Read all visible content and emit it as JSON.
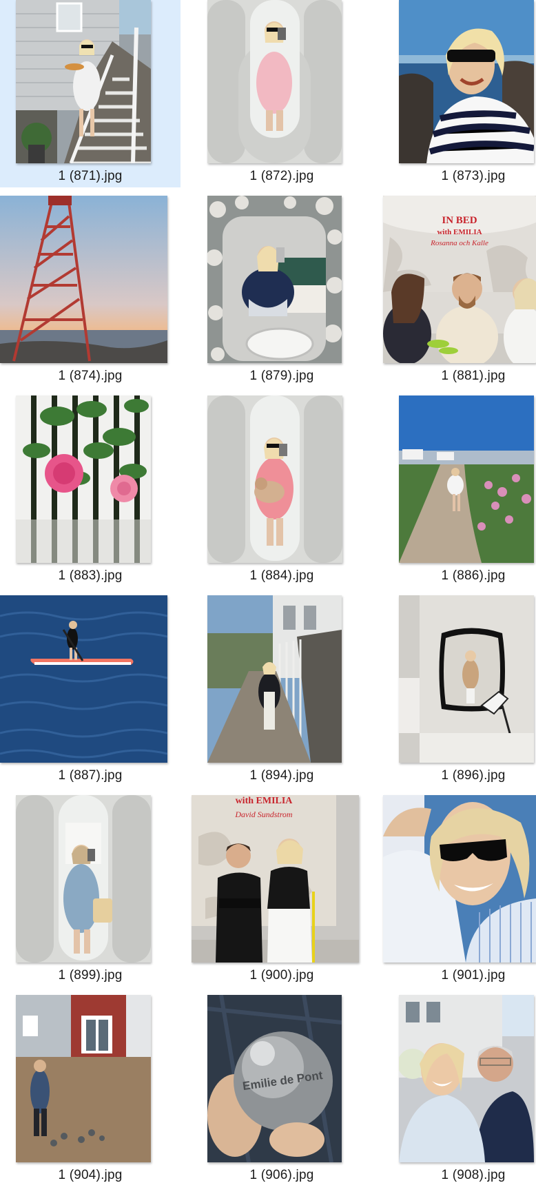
{
  "gallery": {
    "selected_index": 0,
    "files": [
      {
        "name": "1 (871).jpg",
        "scene": "woman-on-stairs-photo"
      },
      {
        "name": "1 (872).jpg",
        "scene": "mirror-selfie-photo"
      },
      {
        "name": "1 (873).jpg",
        "scene": "seaside-selfie-photo"
      },
      {
        "name": "1 (874).jpg",
        "scene": "lighthouse-sunset-photo"
      },
      {
        "name": "1 (879).jpg",
        "scene": "floral-mirror-selfie-photo"
      },
      {
        "name": "1 (881).jpg",
        "scene": "podcast-group-photo",
        "overlay_lines": [
          "IN BED",
          "with EMILIA",
          "Rosanna och Kalle"
        ]
      },
      {
        "name": "1 (883).jpg",
        "scene": "pink-rose-photo"
      },
      {
        "name": "1 (884).jpg",
        "scene": "mirror-selfie-dog-photo"
      },
      {
        "name": "1 (886).jpg",
        "scene": "coastal-path-photo"
      },
      {
        "name": "1 (887).jpg",
        "scene": "paddleboard-photo"
      },
      {
        "name": "1 (894).jpg",
        "scene": "village-path-photo"
      },
      {
        "name": "1 (896).jpg",
        "scene": "wall-mirror-room-photo"
      },
      {
        "name": "1 (899).jpg",
        "scene": "mirror-selfie-denim-photo"
      },
      {
        "name": "1 (900).jpg",
        "scene": "podcast-duo-photo",
        "overlay_lines": [
          "with EMILIA",
          "David Sundstrom"
        ]
      },
      {
        "name": "1 (901).jpg",
        "scene": "sunglasses-selfie-photo"
      },
      {
        "name": "1 (904).jpg",
        "scene": "boules-game-photo"
      },
      {
        "name": "1 (906).jpg",
        "scene": "engraved-boule-photo",
        "overlay_lines": [
          "Emilie de Pont"
        ]
      },
      {
        "name": "1 (908).jpg",
        "scene": "couple-selfie-photo"
      }
    ]
  },
  "colors": {
    "selection_bg": "#dcecfc",
    "label_text": "#1a1a1a"
  }
}
